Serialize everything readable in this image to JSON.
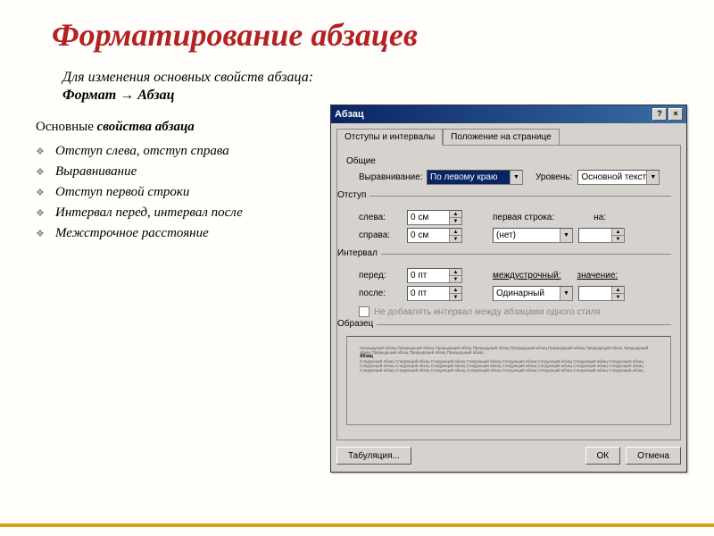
{
  "slide": {
    "title": "Форматирование абзацев",
    "subtitle_line1": "Для изменения основных свойств абзаца:",
    "subtitle_line2": "Формат → Абзац",
    "section_heading_plain": "Основные ",
    "section_heading_ital": "свойства абзаца",
    "bullets": [
      "Отступ слева, отступ справа",
      "Выравнивание",
      "Отступ первой строки",
      "Интервал перед, интервал после",
      "Межстрочное расстояние"
    ]
  },
  "dialog": {
    "title": "Абзац",
    "help_btn": "?",
    "close_btn": "×",
    "tabs": {
      "active": "Отступы и интервалы",
      "other": "Положение на странице"
    },
    "groups": {
      "common": "Общие",
      "indent": "Отступ",
      "interval": "Интервал",
      "sample": "Образец"
    },
    "labels": {
      "align": "Выравнивание:",
      "level": "Уровень:",
      "left": "слева:",
      "right": "справа:",
      "firstline": "первая строка:",
      "by": "на:",
      "before": "перед:",
      "after": "после:",
      "linespacing": "междустрочный:",
      "value": "значение:"
    },
    "values": {
      "align": "По левому краю",
      "level": "Основной текст",
      "left": "0 см",
      "right": "0 см",
      "firstline": "(нет)",
      "by": "",
      "before": "0 пт",
      "after": "0 пт",
      "linespacing": "Одинарный",
      "value": ""
    },
    "checkbox": "Не добавлять интервал между абзацами одного стиля",
    "sample_text": "Предыдущий абзац Предыдущий абзац Предыдущий абзац Предыдущий абзац Предыдущий абзац Предыдущий абзац Предыдущий абзац Предыдущий абзац Предыдущий абзац Предыдущий абзац Предыдущий абзац",
    "sample_bold": "Абзац",
    "sample_after": "Следующий абзац Следующий абзац Следующий абзац Следующий абзац Следующий абзац Следующий абзац Следующий абзац Следующий абзац Следующий абзац Следующий абзац Следующий абзац Следующий абзац Следующий абзац Следующий абзац Следующий абзац Следующий абзац Следующий абзац Следующий абзац Следующий абзац Следующий абзац Следующий абзац Следующий абзац Следующий абзац Следующий абзац",
    "buttons": {
      "tabs": "Табуляция...",
      "ok": "ОК",
      "cancel": "Отмена"
    }
  }
}
